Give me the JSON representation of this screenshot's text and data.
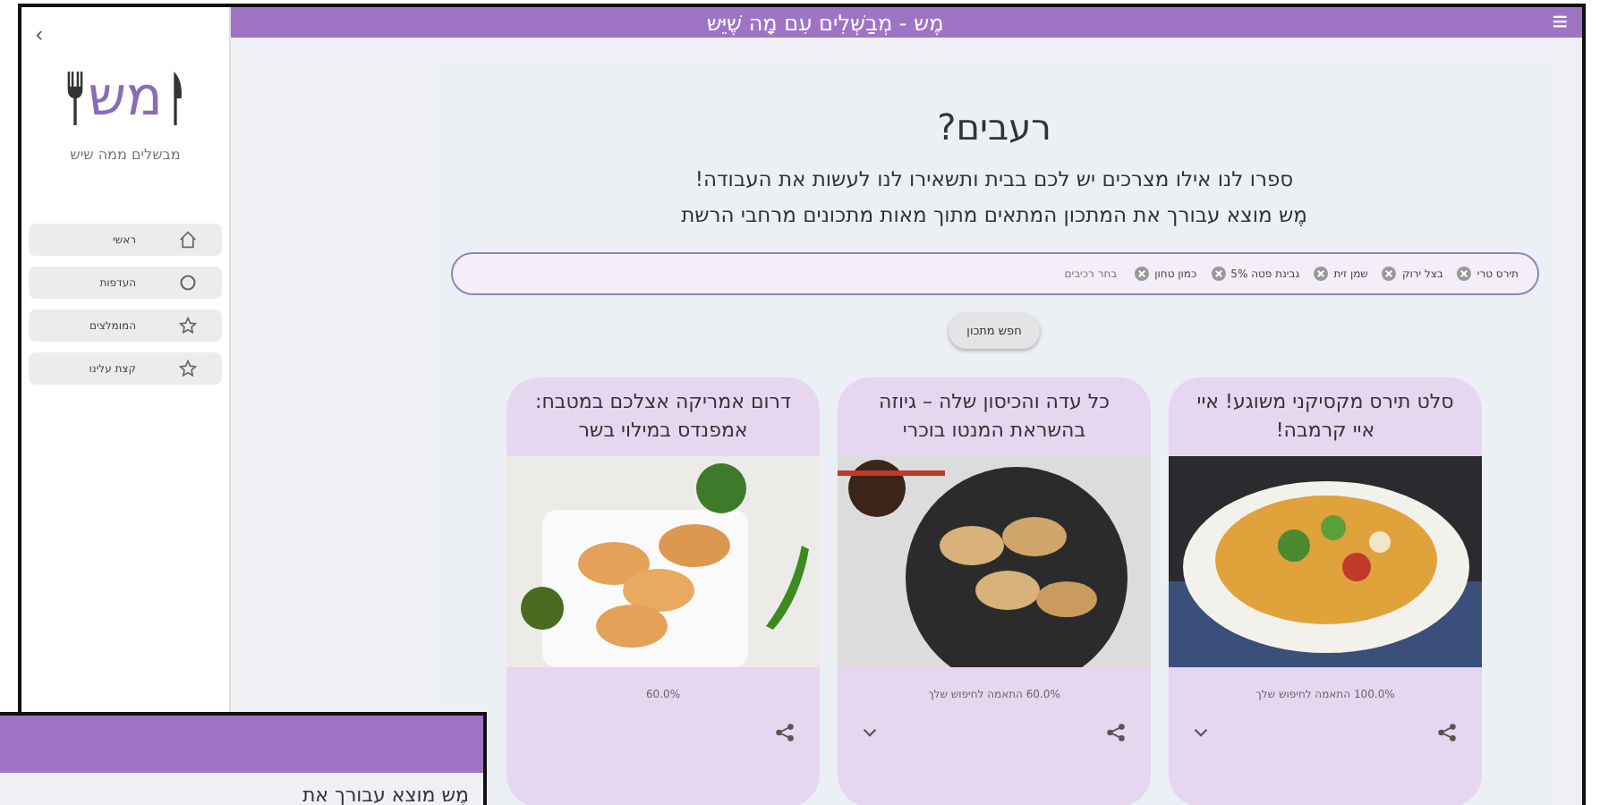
{
  "header": {
    "title": "מֶש - מְבַשְּׁלִים עִם מָה שֶׁיֵּש",
    "menu_icon": "≡"
  },
  "sidebar": {
    "collapse": "›",
    "logo": "מש",
    "tagline": "מבשלים ממה שיש",
    "items": [
      {
        "label": "ראשי"
      },
      {
        "label": "העדפות"
      },
      {
        "label": "המומלצים"
      },
      {
        "label": "קצת עלינו"
      }
    ]
  },
  "hero": {
    "title": "רעבים?",
    "lines": [
      "ספרו לנו אילו מצרכים יש לכם בבית ותשאירו לנו לעשות את העבודה!",
      "מֶש מוצא עבורך את המתכון המתאים מתוך מאות מתכונים מרחבי הרשת"
    ]
  },
  "search": {
    "chips": [
      "תירס טרי",
      "בצל ירוק",
      "שמן זית",
      "גבינת פטה 5%",
      "כמון טחון"
    ],
    "placeholder": "בחר רכיבים",
    "button": "חפש מתכון"
  },
  "cards": [
    {
      "title": "סלט תירס מקסיקני משוגע! איי איי קרמבה!",
      "match": "100.0% התאמה לחיפוש שלך",
      "expand": true
    },
    {
      "title": "כל עדה והכיסון שלה – גיוזה בהשראת המנטו בוכרי",
      "match": "60.0% התאמה לחיפוש שלך",
      "expand": true
    },
    {
      "title": "דרום אמריקה אצלכם במטבח: אמפנדס במילוי בשר",
      "match": "60.0%",
      "expand": false
    }
  ],
  "overlay_window": {
    "text": "מֶש מוצא עבורך את"
  }
}
